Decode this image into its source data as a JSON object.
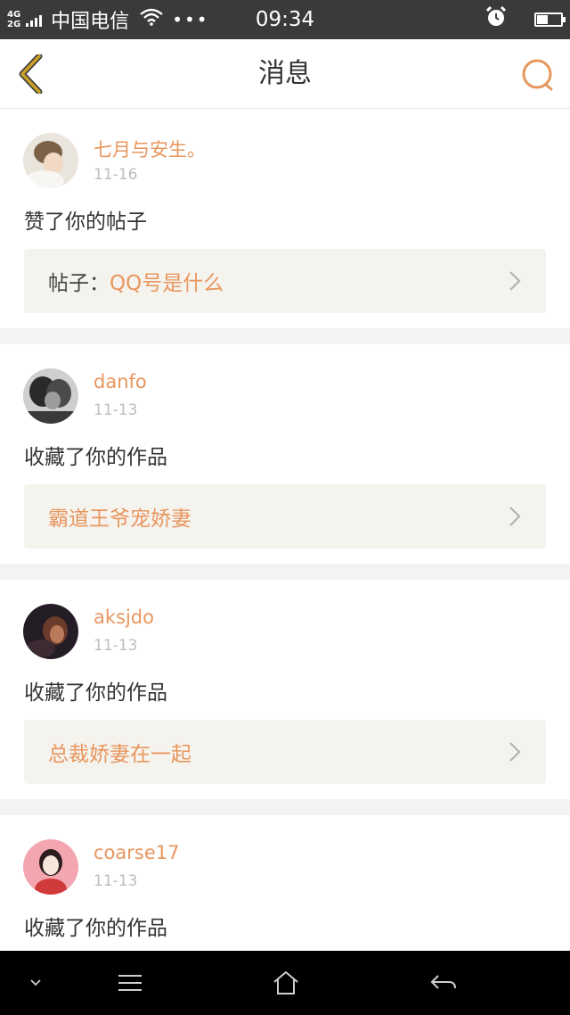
{
  "status_bar": {
    "network_top": "4G",
    "network_bottom": "2G",
    "carrier": "中国电信",
    "dots": "•••",
    "time": "09:34",
    "battery_level": 0.45
  },
  "nav": {
    "title": "消息"
  },
  "messages": [
    {
      "user": "七月与安生。",
      "date": "11-16",
      "action": "赞了你的帖子",
      "ref_prefix": "帖子：",
      "ref_title": "QQ号是什么"
    },
    {
      "user": "danfo",
      "date": "11-13",
      "action": "收藏了你的作品",
      "ref_prefix": "",
      "ref_title": "霸道王爷宠娇妻"
    },
    {
      "user": "aksjdo",
      "date": "11-13",
      "action": "收藏了你的作品",
      "ref_prefix": "",
      "ref_title": "总裁娇妻在一起"
    },
    {
      "user": "coarse17",
      "date": "11-13",
      "action": "收藏了你的作品"
    }
  ],
  "colors": {
    "accent": "#e8965e",
    "back_icon": "#c9a227",
    "status_bar": "#3a3a3a",
    "ref_bg": "#f5f3ee"
  },
  "icons": {
    "back": "chevron-left-icon",
    "search": "search-icon",
    "arrow": "chevron-right-icon",
    "sys_down": "chevron-down-icon",
    "sys_menu": "menu-icon",
    "sys_home": "home-icon",
    "sys_back": "back-arrow-icon"
  }
}
